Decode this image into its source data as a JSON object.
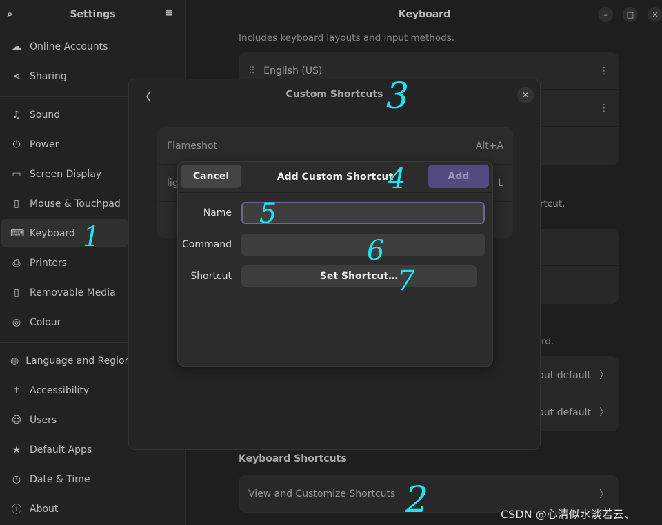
{
  "sidebar": {
    "title": "Settings",
    "items": [
      {
        "label": "Online Accounts",
        "icon": "cloud-icon",
        "glyph": "☁"
      },
      {
        "label": "Sharing",
        "icon": "share-icon",
        "glyph": "⋖"
      },
      {
        "label": "Sound",
        "icon": "music-note-icon",
        "glyph": "♫"
      },
      {
        "label": "Power",
        "icon": "power-icon",
        "glyph": "⏻"
      },
      {
        "label": "Screen Display",
        "icon": "monitor-icon",
        "glyph": "▭"
      },
      {
        "label": "Mouse & Touchpad",
        "icon": "mouse-icon",
        "glyph": "▯"
      },
      {
        "label": "Keyboard",
        "icon": "keyboard-icon",
        "glyph": "⌨"
      },
      {
        "label": "Printers",
        "icon": "printer-icon",
        "glyph": "⎙"
      },
      {
        "label": "Removable Media",
        "icon": "usb-icon",
        "glyph": "▯"
      },
      {
        "label": "Colour",
        "icon": "colour-icon",
        "glyph": "◎"
      },
      {
        "label": "Language and Region",
        "icon": "globe-icon",
        "glyph": "◍"
      },
      {
        "label": "Accessibility",
        "icon": "accessibility-icon",
        "glyph": "✝"
      },
      {
        "label": "Users",
        "icon": "users-icon",
        "glyph": "☺"
      },
      {
        "label": "Default Apps",
        "icon": "star-icon",
        "glyph": "★"
      },
      {
        "label": "Date & Time",
        "icon": "clock-icon",
        "glyph": "◷"
      },
      {
        "label": "About",
        "icon": "info-icon",
        "glyph": "ⓘ"
      }
    ],
    "selected": "Keyboard"
  },
  "window": {
    "title": "Keyboard"
  },
  "main": {
    "input_desc": "Includes keyboard layouts and input methods.",
    "layout1": "English (US)",
    "frag1": "rtcut.",
    "frag2": "rd.",
    "layout_default": "yout default",
    "shortcuts_heading": "Keyboard Shortcuts",
    "view_shortcuts": "View and Customize Shortcuts"
  },
  "custom_shortcuts": {
    "title": "Custom Shortcuts",
    "items": [
      {
        "name": "Flameshot",
        "accel": "Alt+A"
      },
      {
        "name": "lig",
        "accel": "L"
      }
    ]
  },
  "add_dialog": {
    "title": "Add Custom Shortcut",
    "cancel": "Cancel",
    "add": "Add",
    "name_label": "Name",
    "name_value": "",
    "command_label": "Command",
    "command_value": "",
    "shortcut_label": "Shortcut",
    "set_shortcut": "Set Shortcut…"
  },
  "annotations": [
    "1",
    "2",
    "3",
    "4",
    "5",
    "6",
    "7"
  ],
  "watermark": "CSDN @心清似水淡若云、",
  "colors": {
    "accent": "#524a80",
    "annotation": "#19e6f0"
  }
}
